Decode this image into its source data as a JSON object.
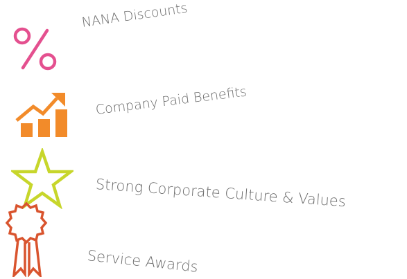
{
  "colors": {
    "percent": "#e4508f",
    "chart": "#f28b2a",
    "star": "#c7d62b",
    "ribbon": "#d9542e",
    "label_text": "#6b6b6b",
    "background": "#ffffff"
  },
  "items": [
    {
      "label": "NANA Discounts",
      "icon": "percent-icon"
    },
    {
      "label": "Company Paid Benefits",
      "icon": "chart-growth-icon"
    },
    {
      "label": "Strong Corporate Culture & Values",
      "icon": "star-icon"
    },
    {
      "label": "Service Awards",
      "icon": "ribbon-award-icon"
    }
  ]
}
